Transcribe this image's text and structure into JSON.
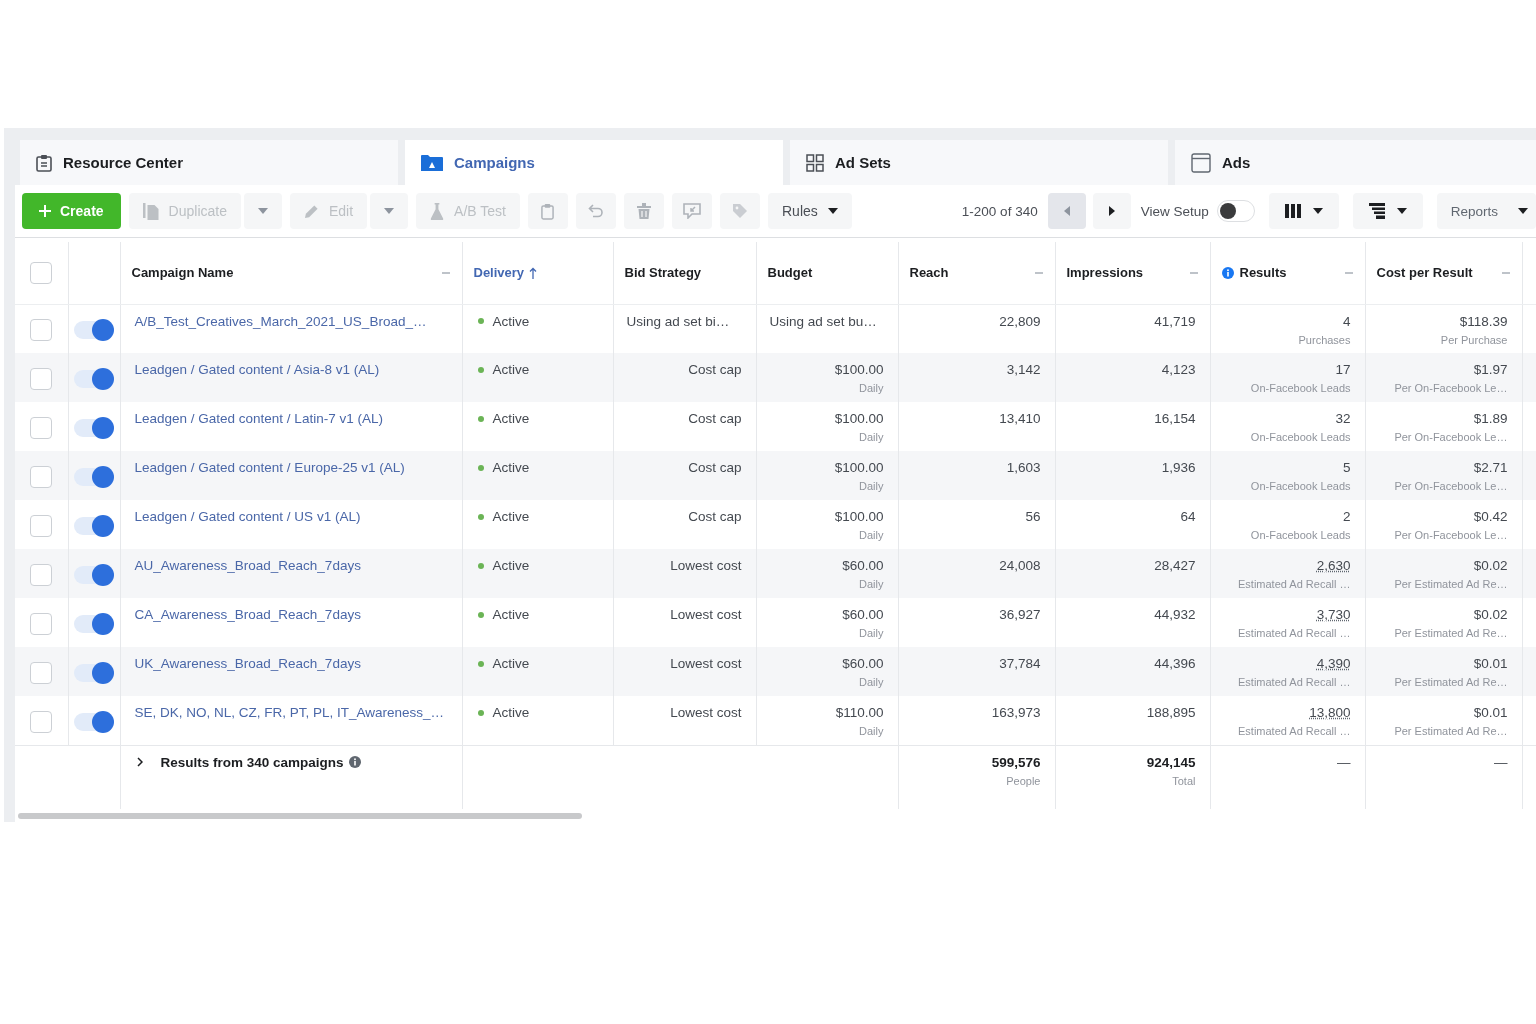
{
  "tabs": [
    {
      "label": "Resource Center",
      "kind": "resources",
      "selected": false
    },
    {
      "label": "Campaigns",
      "kind": "campaigns",
      "selected": true
    },
    {
      "label": "Ad Sets",
      "kind": "ad_sets",
      "selected": false
    },
    {
      "label": "Ads",
      "kind": "ads",
      "selected": false
    }
  ],
  "toolbar": {
    "actions": [
      {
        "kind": "create",
        "label": "Create",
        "disabled": false
      },
      {
        "kind": "duplicate",
        "label": "Duplicate",
        "disabled": true
      },
      {
        "kind": "dropdown",
        "disabled": true
      },
      {
        "kind": "edit",
        "label": "Edit",
        "disabled": true
      },
      {
        "kind": "dropdown",
        "disabled": true
      },
      {
        "kind": "ab_test",
        "label": "A/B Test",
        "disabled": true
      },
      {
        "kind": "clipboard",
        "disabled": true
      },
      {
        "kind": "undo",
        "disabled": true
      },
      {
        "kind": "delete",
        "disabled": true
      },
      {
        "kind": "comment",
        "disabled": true
      },
      {
        "kind": "tag",
        "disabled": true
      },
      {
        "kind": "rules",
        "label": "Rules",
        "disabled": false
      }
    ],
    "pager": {
      "label": "1-200 of 340",
      "prev": {
        "disabled": true
      },
      "next": {
        "disabled": false
      }
    },
    "view_setup": {
      "label": "View Setup",
      "on": false
    },
    "view_buttons": [
      {
        "kind": "columns"
      },
      {
        "kind": "breakdown"
      },
      {
        "kind": "reports",
        "label": "Reports"
      }
    ]
  },
  "table": {
    "select_all": {
      "checked": false
    },
    "columns": [
      {
        "label": "Campaign Name",
        "sorted": false,
        "menu": true,
        "info": false
      },
      {
        "label": "Delivery",
        "sorted": true,
        "menu": false,
        "info": false
      },
      {
        "label": "Bid Strategy",
        "sorted": false,
        "menu": false,
        "info": false
      },
      {
        "label": "Budget",
        "sorted": false,
        "menu": false,
        "info": false
      },
      {
        "label": "Reach",
        "sorted": false,
        "menu": true,
        "info": false
      },
      {
        "label": "Impressions",
        "sorted": false,
        "menu": true,
        "info": false
      },
      {
        "label": "Results",
        "sorted": false,
        "menu": true,
        "info": true
      },
      {
        "label": "Cost per Result",
        "sorted": false,
        "menu": true,
        "info": false
      }
    ],
    "rows": [
      {
        "kind": "adset_budget",
        "checked": false,
        "on": true,
        "name": "A/B_Test_Creatives_March_2021_US_Broad_…",
        "delivery": "Active",
        "bid_strategy": "Using ad set bi…",
        "budget": "Using ad set bu…",
        "reach": "22,809",
        "impressions": "41,719",
        "results": "4",
        "results_underlined": false,
        "result_type": "Purchases",
        "cost_per_result": "$118.39",
        "cost_type": "Per Purchase"
      },
      {
        "kind": "campaign_budget",
        "checked": false,
        "on": true,
        "name": "Leadgen / Gated content / Asia-8 v1 (AL)",
        "delivery": "Active",
        "bid_strategy": "Cost cap",
        "budget": "$100.00",
        "budget_period": "Daily",
        "reach": "3,142",
        "impressions": "4,123",
        "results": "17",
        "results_underlined": false,
        "result_type": "On-Facebook Leads",
        "cost_per_result": "$1.97",
        "cost_type": "Per On-Facebook Le…"
      },
      {
        "kind": "campaign_budget",
        "checked": false,
        "on": true,
        "name": "Leadgen / Gated content / Latin-7 v1 (AL)",
        "delivery": "Active",
        "bid_strategy": "Cost cap",
        "budget": "$100.00",
        "budget_period": "Daily",
        "reach": "13,410",
        "impressions": "16,154",
        "results": "32",
        "results_underlined": false,
        "result_type": "On-Facebook Leads",
        "cost_per_result": "$1.89",
        "cost_type": "Per On-Facebook Le…"
      },
      {
        "kind": "campaign_budget",
        "checked": false,
        "on": true,
        "name": "Leadgen / Gated content / Europe-25 v1 (AL)",
        "delivery": "Active",
        "bid_strategy": "Cost cap",
        "budget": "$100.00",
        "budget_period": "Daily",
        "reach": "1,603",
        "impressions": "1,936",
        "results": "5",
        "results_underlined": false,
        "result_type": "On-Facebook Leads",
        "cost_per_result": "$2.71",
        "cost_type": "Per On-Facebook Le…"
      },
      {
        "kind": "campaign_budget",
        "checked": false,
        "on": true,
        "name": "Leadgen / Gated content / US v1 (AL)",
        "delivery": "Active",
        "bid_strategy": "Cost cap",
        "budget": "$100.00",
        "budget_period": "Daily",
        "reach": "56",
        "impressions": "64",
        "results": "2",
        "results_underlined": false,
        "result_type": "On-Facebook Leads",
        "cost_per_result": "$0.42",
        "cost_type": "Per On-Facebook Le…"
      },
      {
        "kind": "campaign_budget",
        "checked": false,
        "on": true,
        "name": "AU_Awareness_Broad_Reach_7days",
        "delivery": "Active",
        "bid_strategy": "Lowest cost",
        "budget": "$60.00",
        "budget_period": "Daily",
        "reach": "24,008",
        "impressions": "28,427",
        "results": "2,630",
        "results_underlined": true,
        "result_type": "Estimated Ad Recall …",
        "cost_per_result": "$0.02",
        "cost_type": "Per Estimated Ad Re…"
      },
      {
        "kind": "campaign_budget",
        "checked": false,
        "on": true,
        "name": "CA_Awareness_Broad_Reach_7days",
        "delivery": "Active",
        "bid_strategy": "Lowest cost",
        "budget": "$60.00",
        "budget_period": "Daily",
        "reach": "36,927",
        "impressions": "44,932",
        "results": "3,730",
        "results_underlined": true,
        "result_type": "Estimated Ad Recall …",
        "cost_per_result": "$0.02",
        "cost_type": "Per Estimated Ad Re…"
      },
      {
        "kind": "campaign_budget",
        "checked": false,
        "on": true,
        "name": "UK_Awareness_Broad_Reach_7days",
        "delivery": "Active",
        "bid_strategy": "Lowest cost",
        "budget": "$60.00",
        "budget_period": "Daily",
        "reach": "37,784",
        "impressions": "44,396",
        "results": "4,390",
        "results_underlined": true,
        "result_type": "Estimated Ad Recall …",
        "cost_per_result": "$0.01",
        "cost_type": "Per Estimated Ad Re…"
      },
      {
        "kind": "campaign_budget",
        "checked": false,
        "on": true,
        "name": "SE, DK, NO, NL, CZ, FR, PT, PL, IT_Awareness_…",
        "delivery": "Active",
        "bid_strategy": "Lowest cost",
        "budget": "$110.00",
        "budget_period": "Daily",
        "reach": "163,973",
        "impressions": "188,895",
        "results": "13,800",
        "results_underlined": true,
        "result_type": "Estimated Ad Recall …",
        "cost_per_result": "$0.01",
        "cost_type": "Per Estimated Ad Re…"
      }
    ],
    "summary": {
      "label": "Results from 340 campaigns",
      "reach": "599,576",
      "reach_unit": "People",
      "impressions": "924,145",
      "impressions_unit": "Total",
      "results": "—",
      "cost_per_result": "—"
    }
  }
}
